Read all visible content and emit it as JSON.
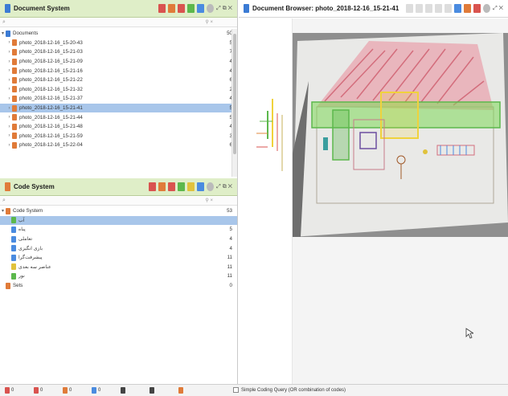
{
  "document_system": {
    "title": "Document System",
    "root_label": "Documents",
    "root_count": "50",
    "documents": [
      {
        "name": "photo_2018-12-16_15-20-43",
        "count": "5"
      },
      {
        "name": "photo_2018-12-16_15-21-03",
        "count": "7"
      },
      {
        "name": "photo_2018-12-16_15-21-09",
        "count": "4"
      },
      {
        "name": "photo_2018-12-16_15-21-16",
        "count": "4"
      },
      {
        "name": "photo_2018-12-16_15-21-22",
        "count": "6"
      },
      {
        "name": "photo_2018-12-16_15-21-32",
        "count": "2"
      },
      {
        "name": "photo_2018-12-16_15-21-37",
        "count": "4"
      },
      {
        "name": "photo_2018-12-16_15-21-41",
        "count": "5"
      },
      {
        "name": "photo_2018-12-16_15-21-44",
        "count": "5"
      },
      {
        "name": "photo_2018-12-16_15-21-48",
        "count": "4"
      },
      {
        "name": "photo_2018-12-16_15-21-59",
        "count": "3"
      },
      {
        "name": "photo_2018-12-16_15-22-04",
        "count": "6"
      }
    ]
  },
  "code_system": {
    "title": "Code System",
    "root_label": "Code System",
    "root_count": "53",
    "codes": [
      {
        "name": "آب",
        "count": "",
        "color": "#5cb84c"
      },
      {
        "name": "پناه",
        "count": "5",
        "color": "#4a8be0"
      },
      {
        "name": "تعاملی",
        "count": "4",
        "color": "#4a8be0"
      },
      {
        "name": "بازی انگیزی",
        "count": "4",
        "color": "#4a8be0"
      },
      {
        "name": "پیشرفت‌گرا",
        "count": "11",
        "color": "#4a8be0"
      },
      {
        "name": "عناصر سه بعدی",
        "count": "11",
        "color": "#e0c23c"
      },
      {
        "name": "نور",
        "count": "11",
        "color": "#5cb84c"
      }
    ],
    "sets_label": "Sets",
    "sets_count": "0"
  },
  "document_browser": {
    "title": "Document Browser: photo_2018-12-16_15-21-41"
  },
  "status_bar": {
    "items": [
      {
        "count": "0",
        "color": "#d9534f"
      },
      {
        "count": "0",
        "color": "#d9534f"
      },
      {
        "count": "0",
        "color": "#e07b39"
      },
      {
        "count": "0",
        "color": "#4a8be0"
      },
      {
        "count": "",
        "color": "#444444"
      },
      {
        "count": "",
        "color": "#444444"
      },
      {
        "count": "",
        "color": "#e07b39"
      }
    ],
    "query_label": "Simple Coding Query (OR combination of codes)"
  },
  "colors": {
    "header_bg": "#dfeec8",
    "selection": "#a8c6ea",
    "code_green": "#5cb84c",
    "code_yellow": "#f0d23c"
  }
}
